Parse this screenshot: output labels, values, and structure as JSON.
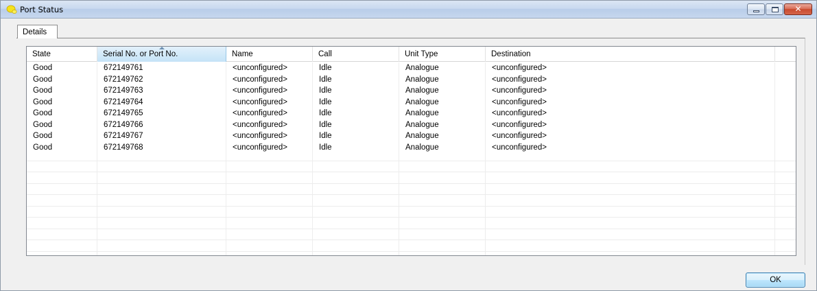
{
  "window": {
    "title": "Port Status",
    "minimize_icon": "minimize-icon",
    "maximize_icon": "maximize-icon",
    "close_icon": "close-icon",
    "close_glyph": "✕",
    "app_icon": "app-bubble-icon",
    "accent": "#c94a2e"
  },
  "tabs": [
    {
      "label": "Details",
      "active": true
    }
  ],
  "table": {
    "columns": [
      "State",
      "Serial No. or Port No.",
      "Name",
      "Call",
      "Unit Type",
      "Destination"
    ],
    "sorted_column": "Serial No. or Port No.",
    "sort_direction": "ascending",
    "rows": [
      [
        "Good",
        "672149761",
        "<unconfigured>",
        "Idle",
        "Analogue",
        "<unconfigured>"
      ],
      [
        "Good",
        "672149762",
        "<unconfigured>",
        "Idle",
        "Analogue",
        "<unconfigured>"
      ],
      [
        "Good",
        "672149763",
        "<unconfigured>",
        "Idle",
        "Analogue",
        "<unconfigured>"
      ],
      [
        "Good",
        "672149764",
        "<unconfigured>",
        "Idle",
        "Analogue",
        "<unconfigured>"
      ],
      [
        "Good",
        "672149765",
        "<unconfigured>",
        "Idle",
        "Analogue",
        "<unconfigured>"
      ],
      [
        "Good",
        "672149766",
        "<unconfigured>",
        "Idle",
        "Analogue",
        "<unconfigured>"
      ],
      [
        "Good",
        "672149767",
        "<unconfigured>",
        "Idle",
        "Analogue",
        "<unconfigured>"
      ],
      [
        "Good",
        "672149768",
        "<unconfigured>",
        "Idle",
        "Analogue",
        "<unconfigured>"
      ]
    ]
  },
  "footer": {
    "ok_label": "OK"
  }
}
